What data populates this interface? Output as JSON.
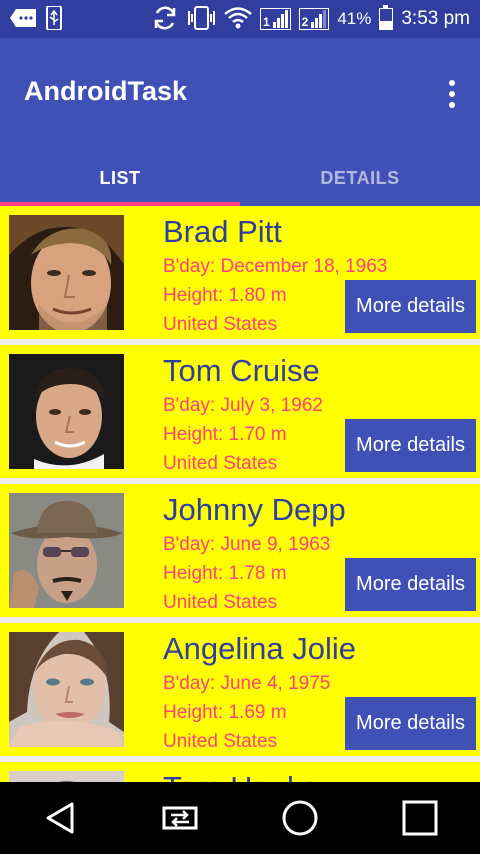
{
  "status_bar": {
    "battery": "41%",
    "time": "3:53 pm",
    "sim1": "1",
    "sim2": "2",
    "icons": [
      "message-icon",
      "usb-icon",
      "sync-icon",
      "vibrate-icon",
      "wifi-icon",
      "signal-icon",
      "battery-icon"
    ]
  },
  "app_bar": {
    "title": "AndroidTask",
    "overflow_icon": "more-vert-icon"
  },
  "tabs": [
    {
      "label": "LIST",
      "active": true
    },
    {
      "label": "DETAILS",
      "active": false
    }
  ],
  "people": [
    {
      "name": "Brad Pitt",
      "bday": "B'day: December 18, 1963",
      "height": "Height: 1.80 m",
      "country": "United States",
      "button": "More details",
      "photo": "brad-pitt-photo"
    },
    {
      "name": "Tom Cruise",
      "bday": "B'day: July 3, 1962",
      "height": "Height: 1.70 m",
      "country": "United States",
      "button": "More details",
      "photo": "tom-cruise-photo"
    },
    {
      "name": "Johnny Depp",
      "bday": "B'day: June 9, 1963",
      "height": "Height: 1.78 m",
      "country": "United States",
      "button": "More details",
      "photo": "johnny-depp-photo"
    },
    {
      "name": "Angelina Jolie",
      "bday": "B'day: June 4, 1975",
      "height": "Height: 1.69 m",
      "country": "United States",
      "button": "More details",
      "photo": "angelina-jolie-photo"
    },
    {
      "name": "Tom Hanks",
      "photo": "tom-hanks-photo"
    }
  ],
  "nav_bar": {
    "icons": [
      "back-icon",
      "recent-switch-icon",
      "home-icon",
      "overview-icon"
    ]
  },
  "colors": {
    "primary": "#3F51B5",
    "primary_dark": "#303F9F",
    "accent": "#FF4081",
    "card": "#FFFF00"
  }
}
